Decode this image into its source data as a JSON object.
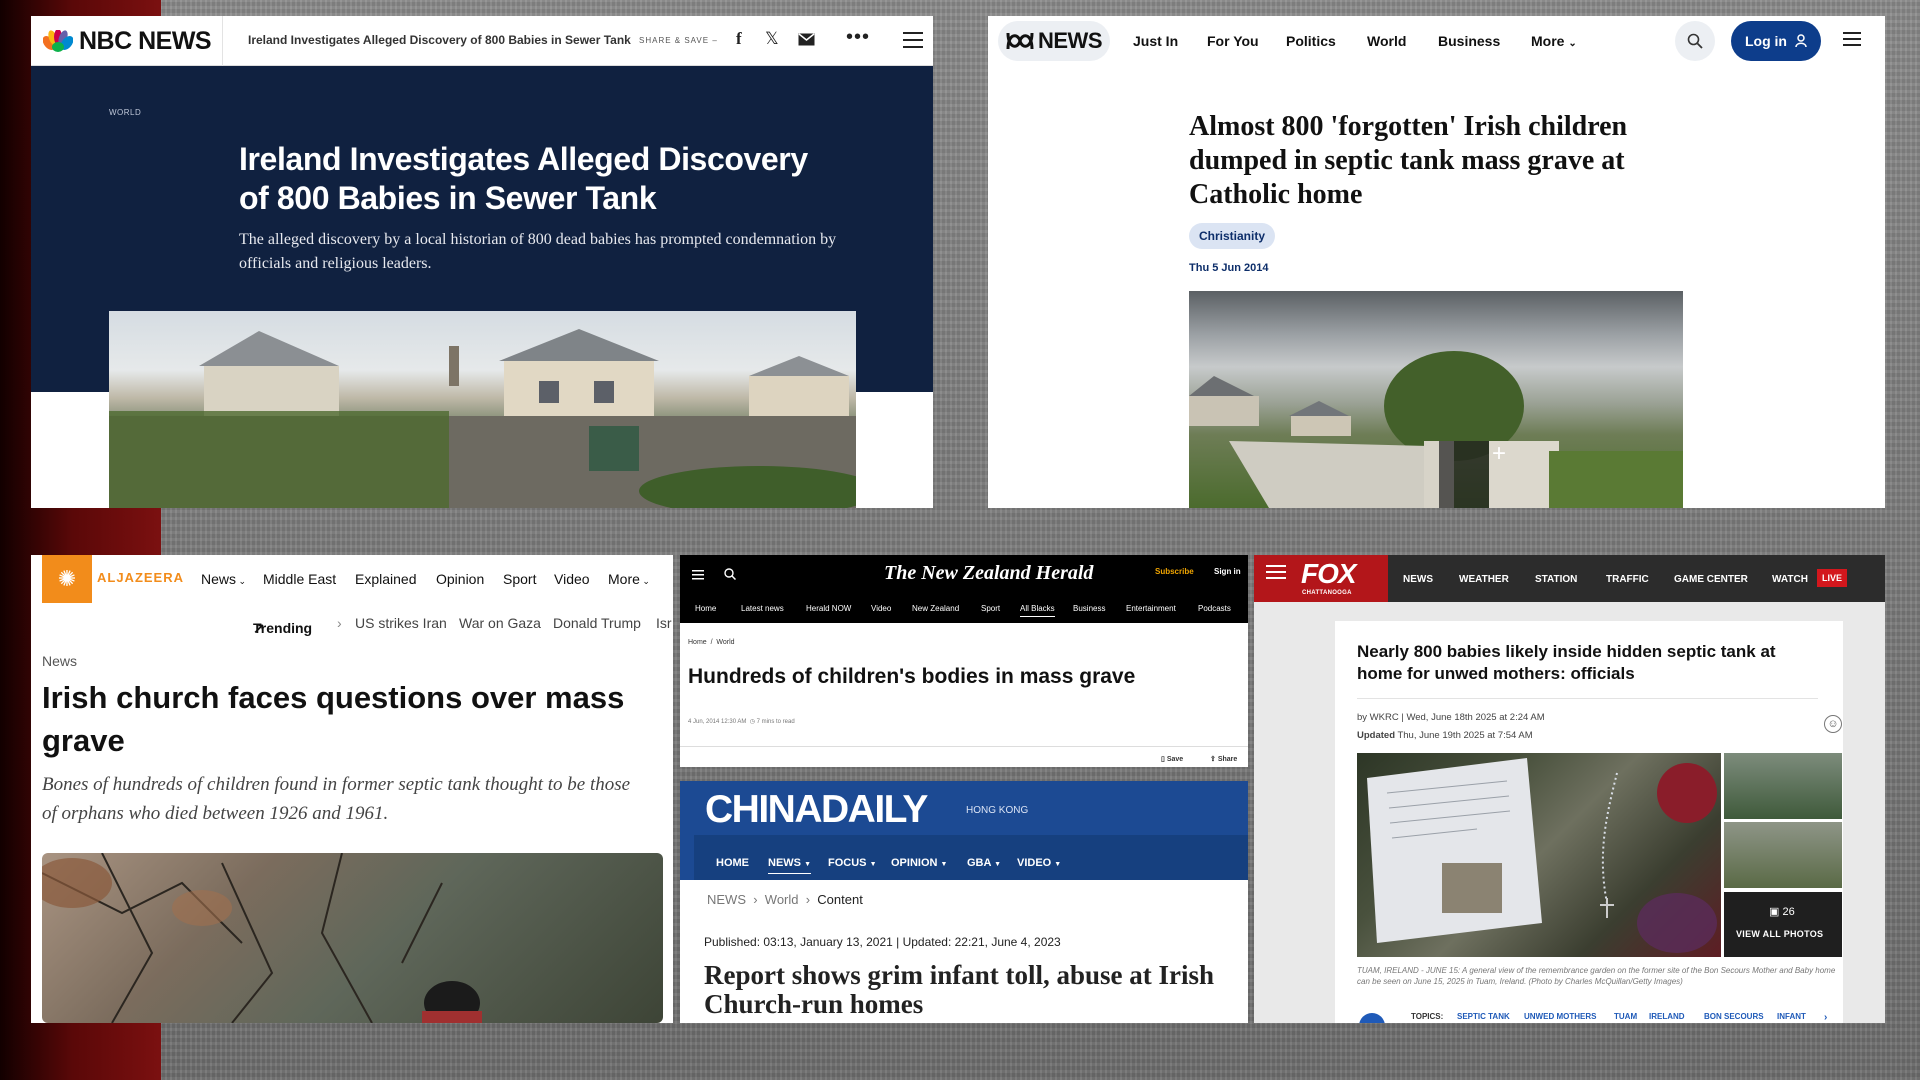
{
  "nbc": {
    "brand": "NBC NEWS",
    "bar_title": "Ireland Investigates Alleged Discovery of 800 Babies in Sewer Tank",
    "share_label": "SHARE & SAVE",
    "category": "WORLD",
    "headline": "Ireland Investigates Alleged Discovery of 800 Babies in Sewer Tank",
    "dek": "The alleged discovery by a local historian of 800 dead babies has prompted condemnation by officials and religious leaders."
  },
  "abc": {
    "brand": "NEWS",
    "nav": [
      "Just In",
      "For You",
      "Politics",
      "World",
      "Business",
      "More"
    ],
    "login_label": "Log in",
    "headline": "Almost 800 'forgotten' Irish children dumped in septic tank mass grave at Catholic home",
    "tag": "Christianity",
    "date": "Thu 5 Jun 2014"
  },
  "aljazeera": {
    "brand": "ALJAZEERA",
    "nav": [
      "News",
      "Middle East",
      "Explained",
      "Opinion",
      "Sport",
      "Video",
      "More"
    ],
    "trending_label": "Trending",
    "trending": [
      "US strikes Iran",
      "War on Gaza",
      "Donald Trump",
      "Isr"
    ],
    "kicker": "News",
    "headline": "Irish church faces questions over mass grave",
    "dek": "Bones of hundreds of children found in former septic tank thought to be those of orphans who died between 1926 and 1961."
  },
  "nzherald": {
    "masthead": "The New Zealand Herald",
    "subscribe": "Subscribe",
    "signin": "Sign in",
    "nav": [
      "Home",
      "Latest news",
      "Herald NOW",
      "Video",
      "New Zealand",
      "Sport",
      "All Blacks",
      "Business",
      "Entertainment",
      "Podcasts"
    ],
    "breadcrumb": [
      "Home",
      "World"
    ],
    "headline": "Hundreds of children's bodies in mass grave",
    "meta_date": "4 Jun, 2014 12:30 AM",
    "meta_read": "7 mins to read",
    "save_label": "Save",
    "share_label": "Share"
  },
  "chinadaily": {
    "masthead": "CHINADAILY",
    "region": "HONG KONG",
    "nav": [
      "HOME",
      "NEWS",
      "FOCUS",
      "OPINION",
      "GBA",
      "VIDEO"
    ],
    "breadcrumb": [
      "NEWS",
      "World",
      "Content"
    ],
    "published": "Published: 03:13, January 13, 2021 | Updated: 22:21, June 4, 2023",
    "headline": "Report shows grim infant toll, abuse at Irish Church-run homes"
  },
  "fox": {
    "brand": "FOX",
    "sub_brand": "CHATTANOOGA",
    "nav": [
      "NEWS",
      "WEATHER",
      "STATION",
      "TRAFFIC",
      "GAME CENTER",
      "WATCH"
    ],
    "live_label": "LIVE",
    "headline": "Nearly 800 babies likely inside hidden septic tank at home for unwed mothers: officials",
    "byline": "by WKRC | Wed, June 18th 2025 at 2:24 AM",
    "updated_label": "Updated",
    "updated": "Thu, June 19th 2025 at 7:54 AM",
    "photo_count": "26",
    "view_all_label": "VIEW ALL PHOTOS",
    "caption": "TUAM, IRELAND - JUNE 15: A general view of the remembrance garden on the former site of the Bon Secours Mother and Baby home can be seen on June 15, 2025 in Tuam, Ireland.  (Photo by Charles McQuillan/Getty Images)",
    "topics_label": "TOPICS:",
    "topics": [
      "SEPTIC TANK",
      "UNWED MOTHERS",
      "TUAM",
      "IRELAND",
      "BON SECOURS",
      "INFANT"
    ]
  }
}
